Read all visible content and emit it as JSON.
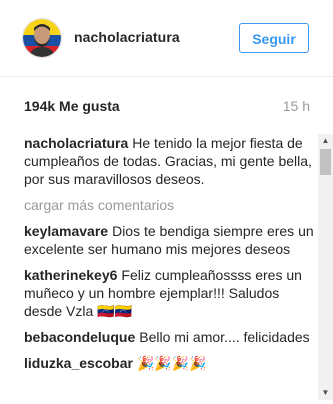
{
  "header": {
    "username": "nacholacriatura",
    "follow_label": "Seguir"
  },
  "post": {
    "likes": "194k Me gusta",
    "time_ago": "15 h"
  },
  "caption": {
    "user": "nacholacriatura",
    "text": "He tenido la mejor fiesta de cumpleaños de todas. Gracias, mi gente bella, por sus maravillosos deseos."
  },
  "load_more_label": "cargar más comentarios",
  "comments": [
    {
      "user": "keylamavare",
      "text": "Dios te bendiga siempre eres un excelente ser humano mis mejores deseos"
    },
    {
      "user": "katherinekey6",
      "text": "Feliz cumpleañossss eres un muñeco y un hombre ejemplar!!! Saludos desde Vzla 🇻🇪🇻🇪"
    },
    {
      "user": "bebacondeluque",
      "text": "Bello mi amor.... felicidades"
    },
    {
      "user": "liduzka_escobar",
      "text": "🎉🎉🎉🎉"
    }
  ],
  "colors": {
    "accent": "#3897f0",
    "muted": "#999999",
    "text": "#262626"
  }
}
